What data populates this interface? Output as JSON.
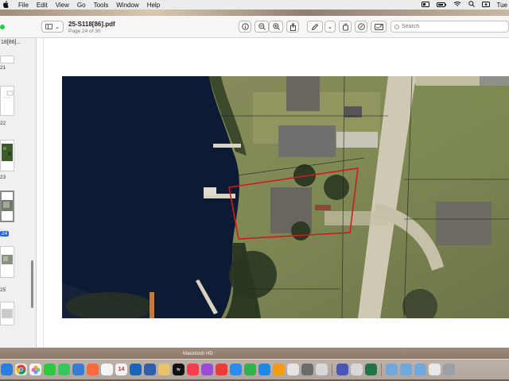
{
  "menubar": {
    "items": [
      "File",
      "Edit",
      "View",
      "Go",
      "Tools",
      "Window",
      "Help"
    ],
    "clock": "Tue"
  },
  "window": {
    "title": "25-S118[86].pdf",
    "subtitle": "Page 24 of 30",
    "search_placeholder": "Search"
  },
  "dock": {
    "label": "Macintosh HD",
    "icon_date": "14",
    "icon_tv": "tv"
  },
  "sidebar": {
    "header": "18[86]...",
    "pages": [
      {
        "label": "21"
      },
      {
        "label": "22"
      },
      {
        "label": "23"
      },
      {
        "label": "24",
        "active": true
      },
      {
        "label": "25"
      }
    ]
  },
  "colors": {
    "selection": "#2962d9",
    "parcel_outline": "#d11a1a",
    "water": "#0d1a33"
  }
}
